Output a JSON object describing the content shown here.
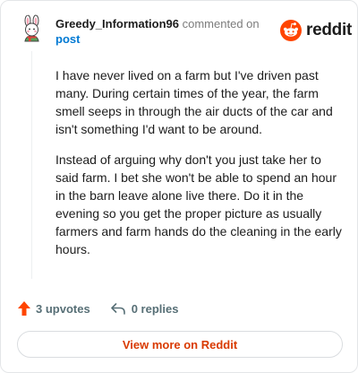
{
  "comment": {
    "username": "Greedy_Information96",
    "action_text": "commented on",
    "post_link_text": "post",
    "paragraphs": [
      "I have never lived on a farm but I've driven past many. During certain times of the year, the farm smell seeps in through the air ducts of the car and isn't something I'd want to be around.",
      "Instead of arguing why don't you just take her to said farm. I bet she won't be able to spend an hour in the barn leave alone live there. Do it in the evening so you get the proper picture as usually farmers and farm hands do the cleaning in the early hours."
    ]
  },
  "brand": {
    "wordmark": "reddit",
    "icon": "reddit-snoo-icon",
    "color": "#ff4500"
  },
  "footer": {
    "upvotes_label": "3 upvotes",
    "replies_label": "0 replies",
    "upvote_icon": "upvote-arrow-icon",
    "reply_icon": "reply-arrow-icon",
    "upvote_color": "#ff4500"
  },
  "cta": {
    "label": "View more on Reddit",
    "color": "#d93a00"
  },
  "avatar": {
    "icon": "bunny-avatar-icon"
  }
}
